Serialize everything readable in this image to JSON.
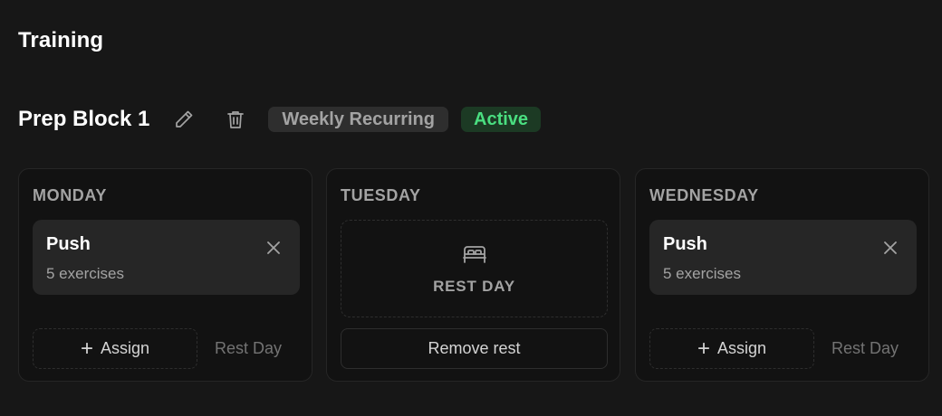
{
  "page": {
    "title": "Training"
  },
  "block": {
    "name": "Prep Block 1",
    "recurrence_badge": "Weekly Recurring",
    "status_badge": "Active",
    "edit_icon": "pencil-icon",
    "delete_icon": "trash-icon"
  },
  "days": [
    {
      "name": "MONDAY",
      "workout": {
        "name": "Push",
        "count": "5 exercises"
      },
      "assign_label": "Assign",
      "rest_label": "Rest Day"
    },
    {
      "name": "TUESDAY",
      "rest": {
        "label": "REST DAY",
        "icon": "bed-icon"
      },
      "remove_rest_label": "Remove rest"
    },
    {
      "name": "WEDNESDAY",
      "workout": {
        "name": "Push",
        "count": "5 exercises"
      },
      "assign_label": "Assign",
      "rest_label": "Rest Day"
    }
  ],
  "colors": {
    "background": "#171717",
    "card": "#121212",
    "active_badge_bg": "#1c3a24",
    "active_badge_text": "#4ade80",
    "muted_text": "#a3a3a3"
  }
}
